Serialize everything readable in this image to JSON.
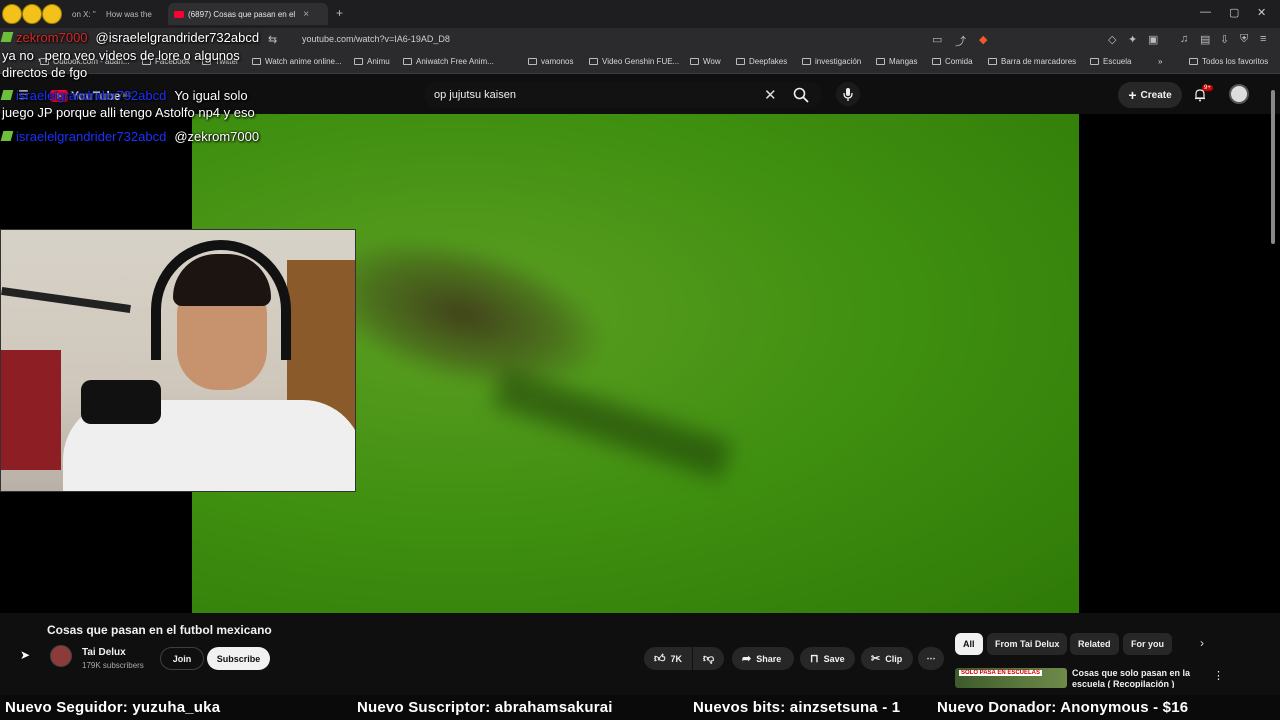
{
  "browser": {
    "tabs": [
      {
        "label": "on X: \"",
        "active": false
      },
      {
        "label": "How was the",
        "active": false
      },
      {
        "label": "(6897) Cosas que pasan en el",
        "active": true
      }
    ],
    "url": "youtube.com/watch?v=IA6-19AD_D8",
    "bookmarks": [
      "Outlook.com - adan...",
      "Facebook",
      "Twitter",
      "Watch anime online...",
      "Animu",
      "Aniwatch Free Anim...",
      "vamonos",
      "Video Genshin FUE...",
      "Wow",
      "Deepfakes",
      "investigación",
      "Mangas",
      "Comida",
      "Barra de marcadores",
      "Escuela",
      "Todos los favoritos"
    ]
  },
  "youtube": {
    "logo": "YouTube",
    "region": "MX",
    "search_value": "op jujutsu kaisen",
    "create_label": "Create",
    "notifications_badge": "9+"
  },
  "chat": [
    {
      "user": "zekrom7000",
      "message": "@israelelgrandrider732abcd"
    },
    {
      "user": "",
      "message": "ya no , pero veo videos de lore o algunos"
    },
    {
      "user": "",
      "message": "directos de fgo"
    },
    {
      "user": "israelelgrandrider732abcd",
      "message": "Yo igual solo"
    },
    {
      "user": "",
      "message": "juego JP porque alli tengo Astolfo np4 y eso"
    },
    {
      "user": "israelelgrandrider732abcd",
      "message": "@zekrom7000"
    }
  ],
  "video": {
    "title": "Cosas que pasan en el futbol mexicano",
    "channel": "Tai Delux",
    "subscribers": "179K subscribers",
    "join_label": "Join",
    "subscribe_label": "Subscribe",
    "likes": "7K",
    "share_label": "Share",
    "save_label": "Save",
    "clip_label": "Clip"
  },
  "chips": [
    "All",
    "From Tai Delux",
    "Related",
    "For you"
  ],
  "recommendation": {
    "thumb_label": "SOLO PASA EN ESCUELAS",
    "title": "Cosas que solo pasan en la escuela ( Recopilación )"
  },
  "alerts": [
    "Nuevo Seguidor: yuzuha_uka",
    "Nuevo Suscriptor: abrahamsakurai",
    "Nuevos bits: ainzsetsuna - 1",
    "Nuevo Donador: Anonymous - $16"
  ],
  "colors": {
    "youtube_red": "#ff0033",
    "chat_username": "#1a31ff",
    "background": "#0f0f0f"
  }
}
